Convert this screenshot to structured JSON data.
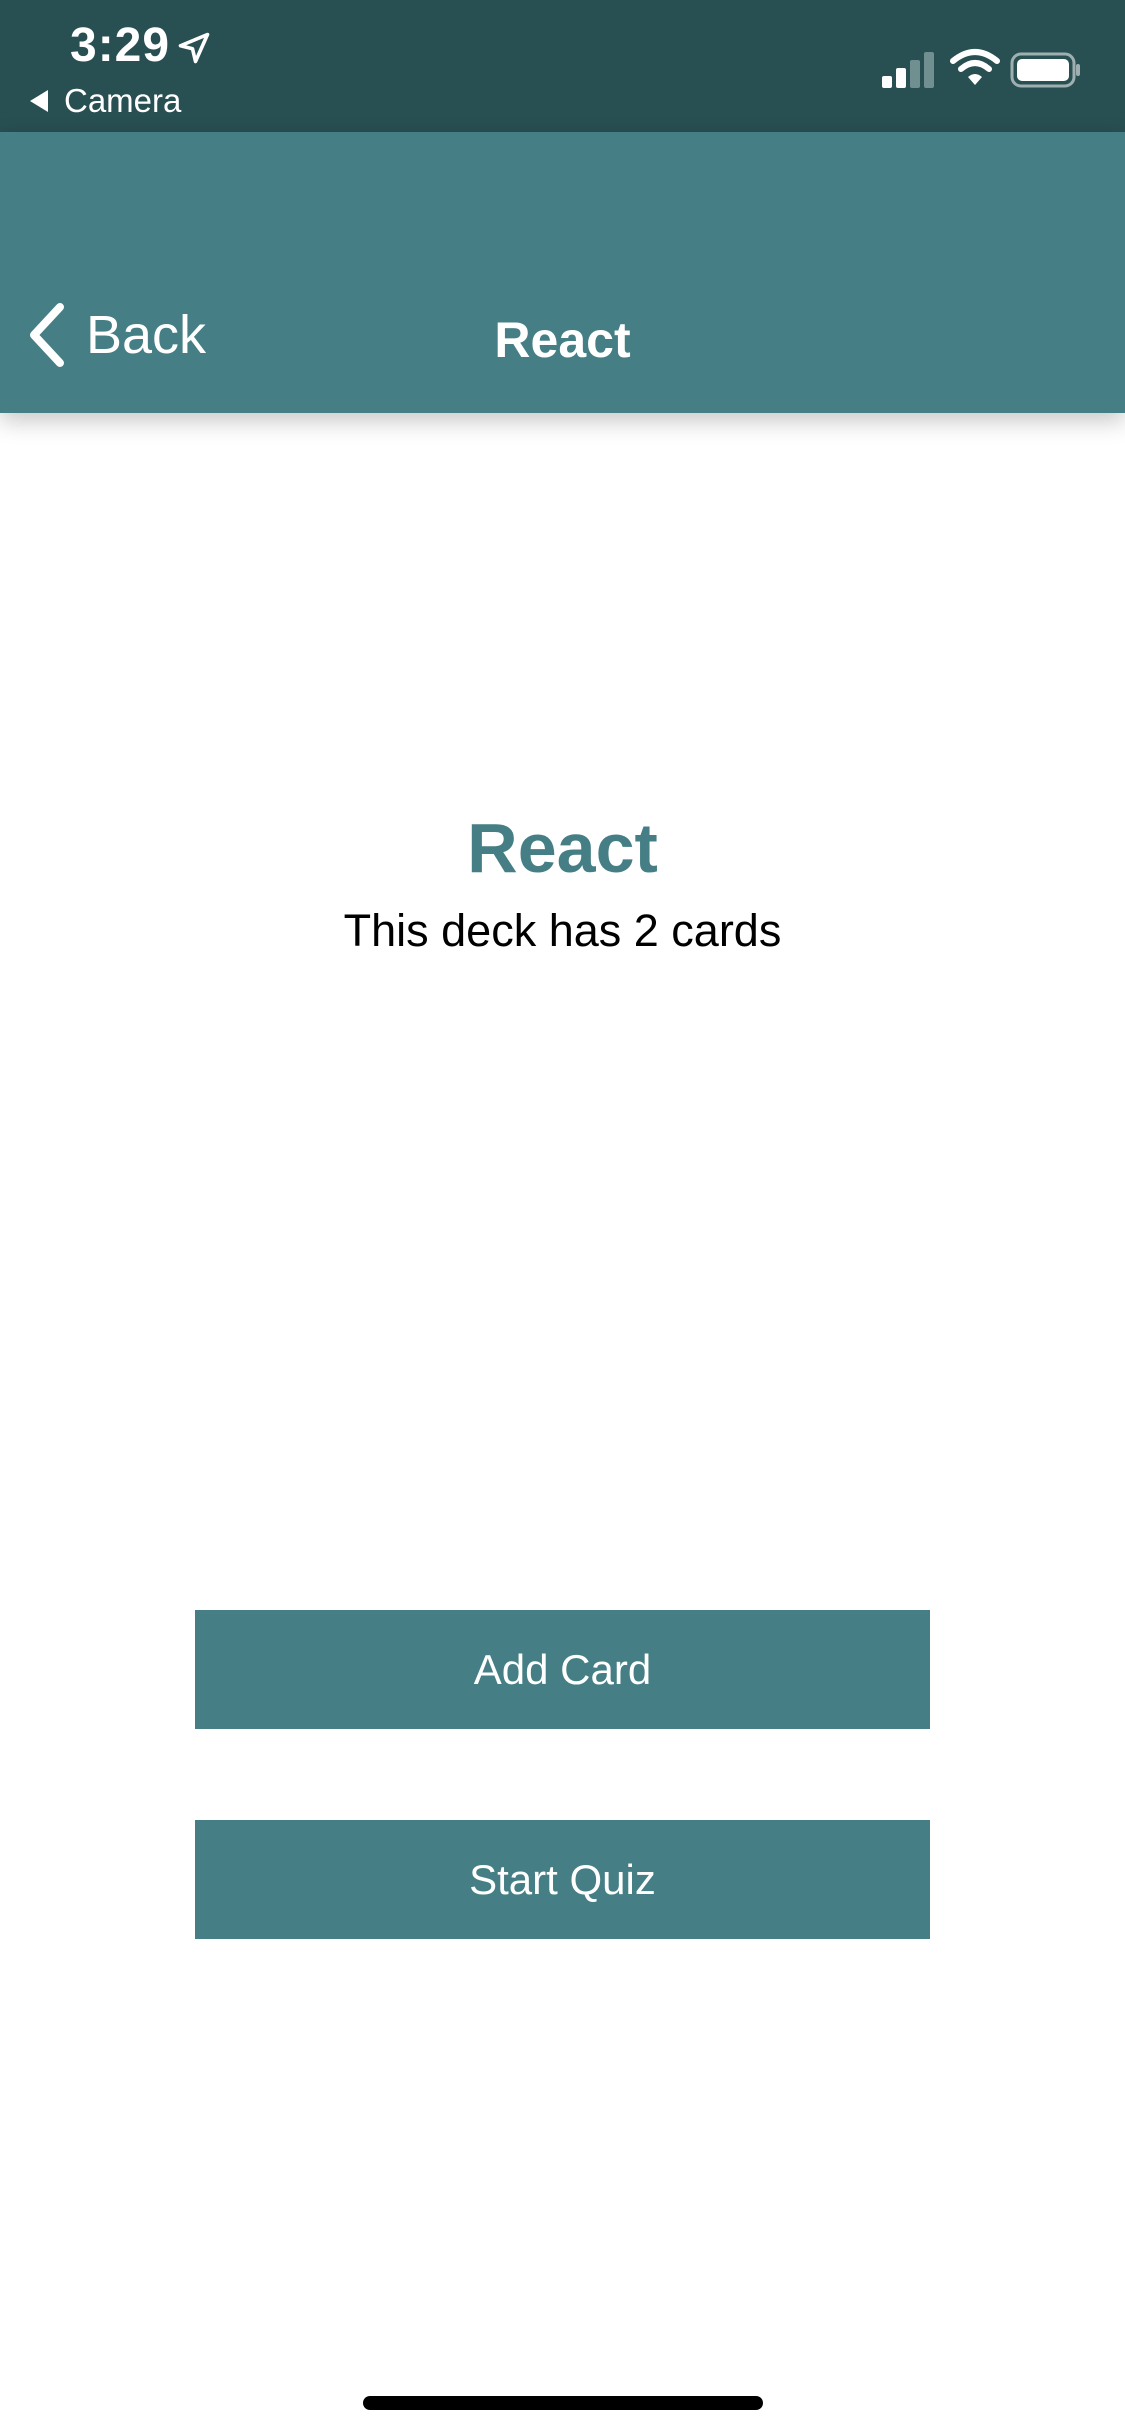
{
  "status_bar": {
    "time": "3:29",
    "back_app_label": "Camera",
    "icons": [
      "location-arrow-icon",
      "signal-icon",
      "wifi-icon",
      "battery-icon"
    ]
  },
  "nav": {
    "back_label": "Back",
    "title": "React"
  },
  "deck": {
    "title": "React",
    "count_text": "This deck has 2 cards"
  },
  "actions": {
    "add_card_label": "Add Card",
    "start_quiz_label": "Start Quiz"
  },
  "colors": {
    "status_bar_bg": "#284f52",
    "header_bg": "#457f85",
    "accent": "#457f85",
    "text": "#000000",
    "background": "#ffffff"
  }
}
